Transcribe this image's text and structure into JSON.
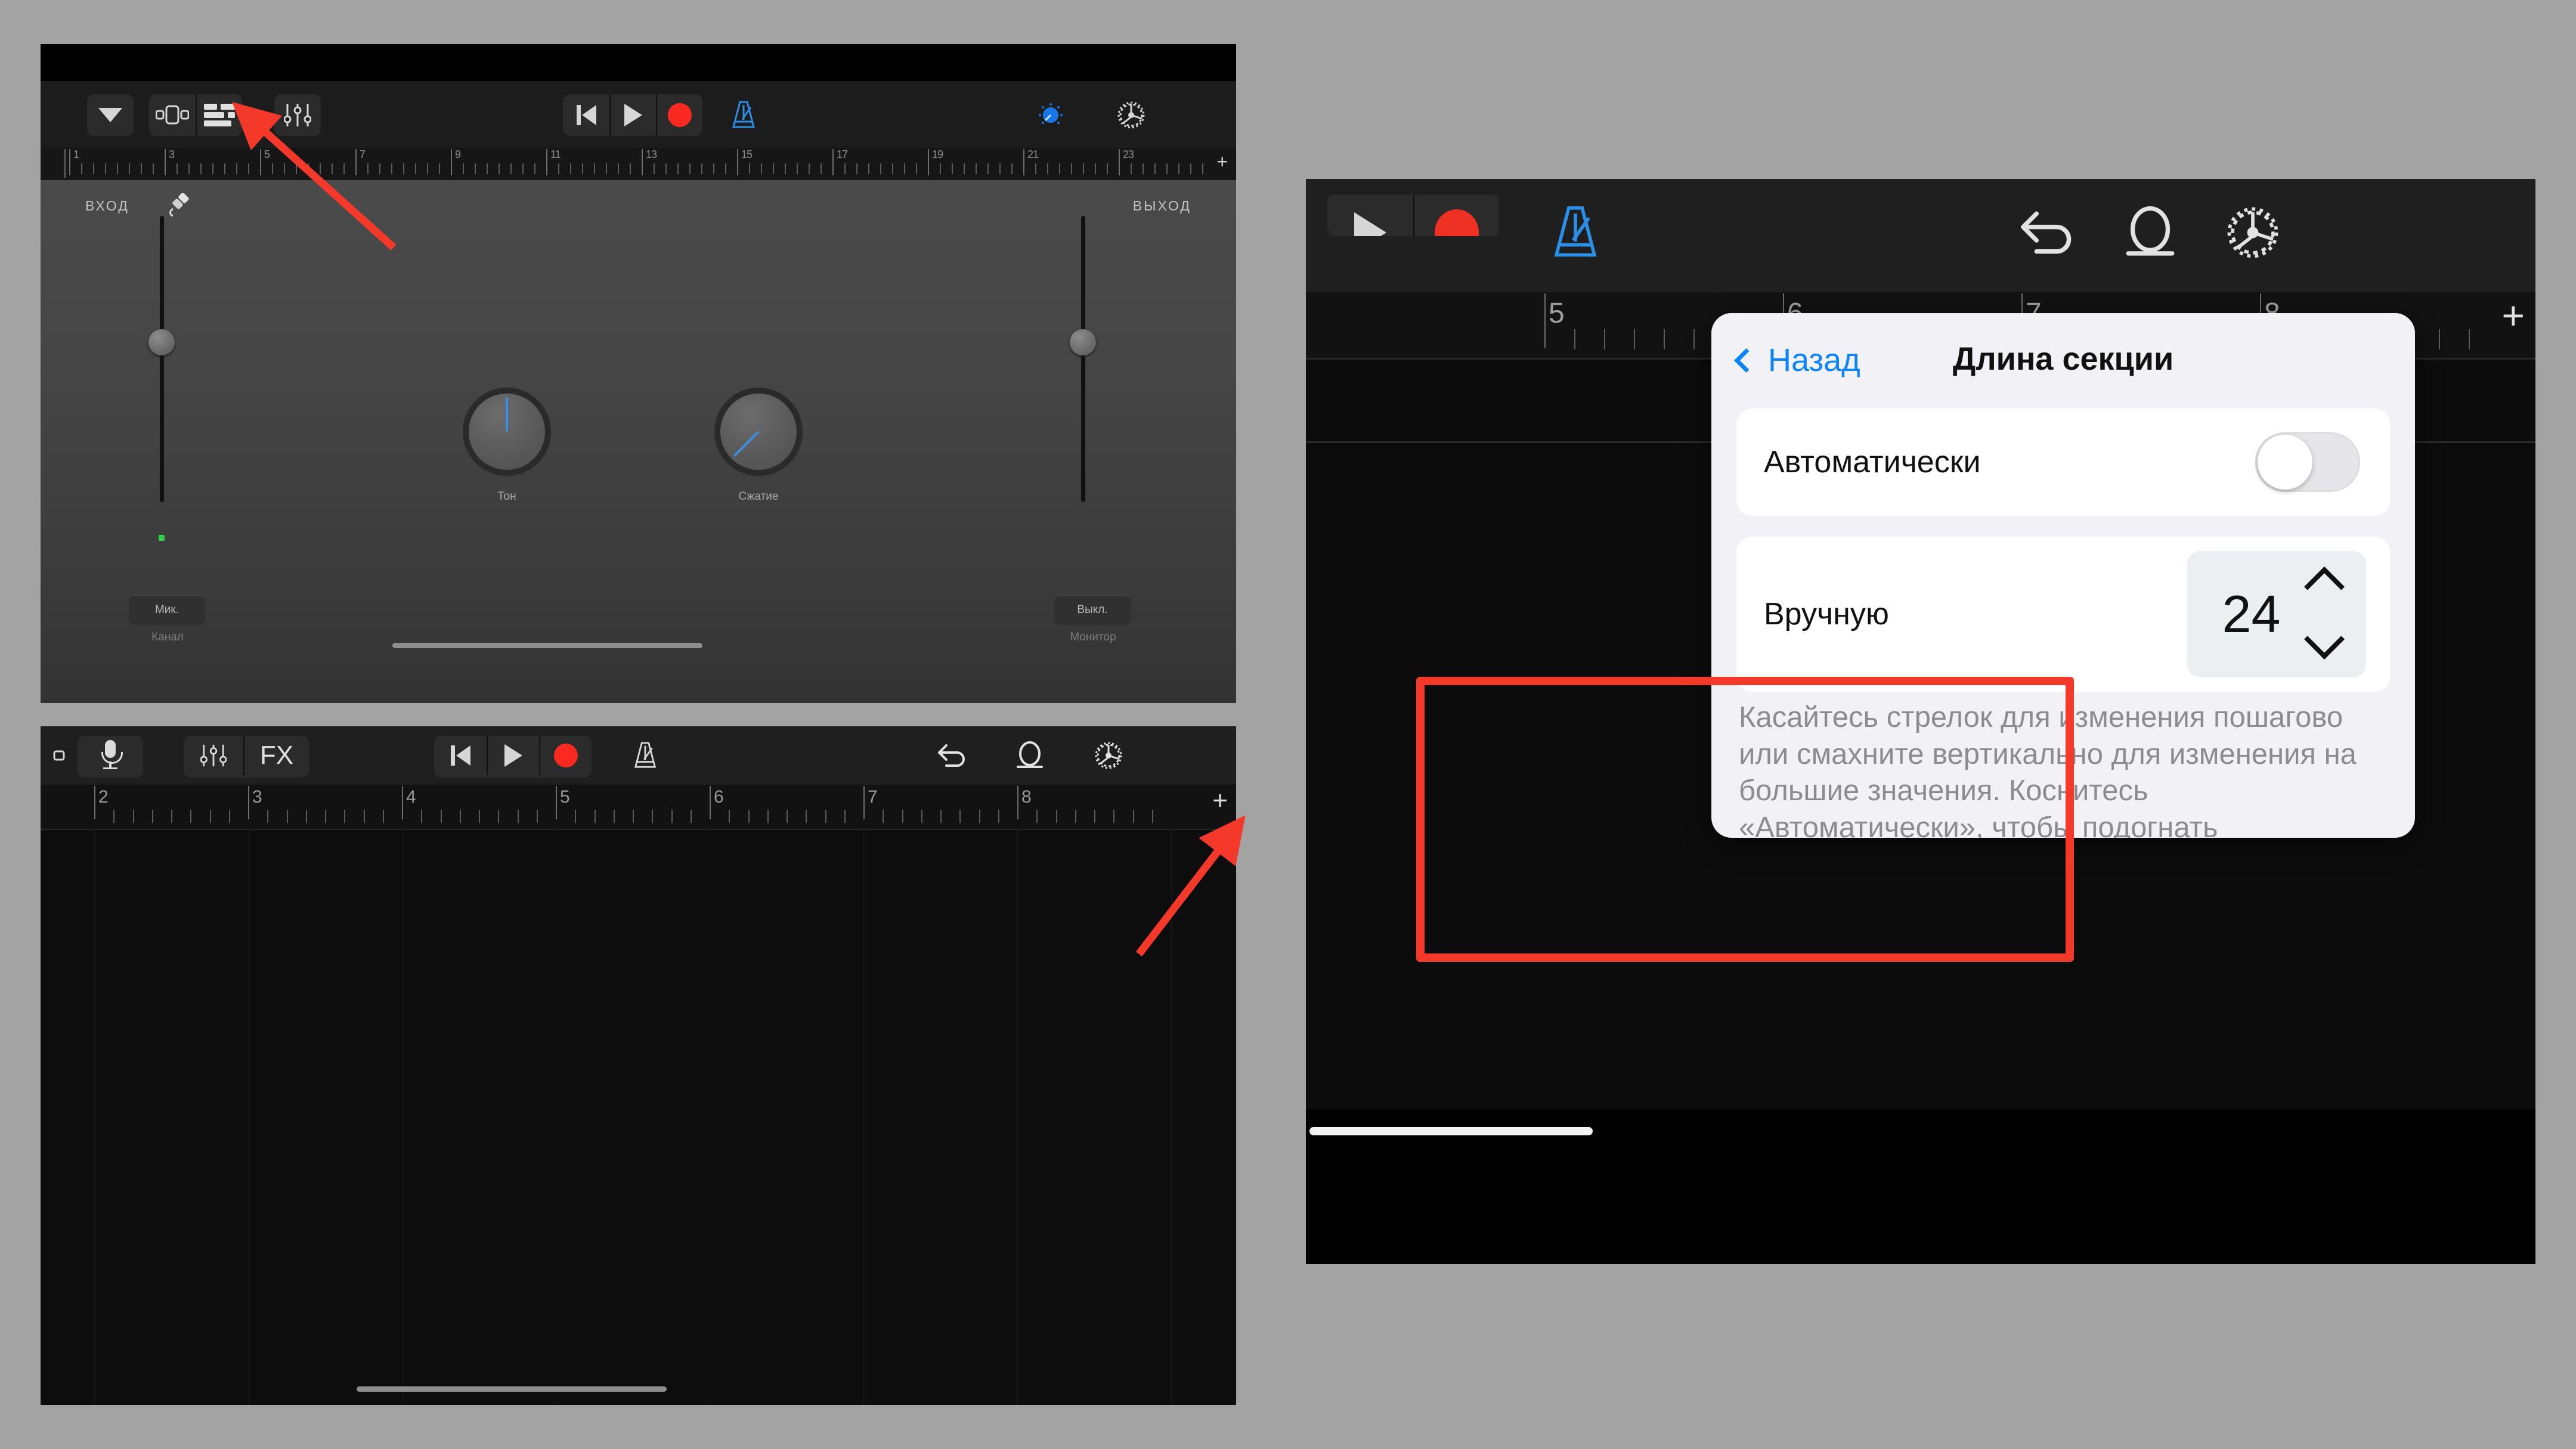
{
  "meta": {
    "accent_blue": "#0a84ff",
    "record_red": "#fb2a20",
    "highlight_red": "#f4392a",
    "metronome_blue": "#2a8fe8"
  },
  "panel_one": {
    "name": "GarageBand track controls panel",
    "toolbar": {
      "left_group": [
        {
          "name": "collapse-triangle-button",
          "icon": "triangle-down-icon"
        },
        {
          "name": "track-view-button",
          "icon": "instrument-view-icon"
        },
        {
          "name": "tracks-list-button",
          "icon": "tracks-list-icon"
        },
        {
          "name": "mixer-button",
          "icon": "sliders-icon"
        }
      ],
      "transport": [
        {
          "name": "rewind-button",
          "icon": "skip-back-icon"
        },
        {
          "name": "play-button",
          "icon": "play-icon"
        },
        {
          "name": "record-button",
          "icon": "record-circle-icon"
        }
      ],
      "metronome": {
        "name": "metronome-button",
        "icon": "metronome-icon",
        "active": true
      },
      "right": [
        {
          "name": "master-effects-button",
          "icon": "knob-blue-icon"
        },
        {
          "name": "settings-button",
          "icon": "gear-icon"
        }
      ]
    },
    "ruler": {
      "labels": [
        "1",
        "3",
        "5",
        "7",
        "9",
        "11",
        "13",
        "15",
        "17",
        "19",
        "21",
        "23"
      ],
      "add_button": "+"
    },
    "input_label": "ВХОД",
    "input_icon": "instrument-plug-icon",
    "output_label": "ВЫХОД",
    "knobs": [
      {
        "label": "Тон",
        "name": "tone-knob",
        "angle_deg": 0
      },
      {
        "label": "Сжатие",
        "name": "compressor-knob",
        "angle_deg": -135
      }
    ],
    "channel": {
      "value": "Мик.",
      "caption": "Канал"
    },
    "monitor": {
      "value": "Выкл.",
      "caption": "Монитор"
    }
  },
  "panel_two": {
    "name": "GarageBand empty tracks view",
    "toolbar": {
      "left": [
        {
          "name": "navigation-button",
          "icon": "small-square-icon"
        },
        {
          "name": "microphone-button",
          "icon": "microphone-icon"
        },
        {
          "name": "mixer-button",
          "icon": "sliders-icon"
        },
        {
          "name": "fx-button",
          "icon": "fx-label-icon",
          "label": "FX"
        }
      ],
      "transport": [
        {
          "name": "rewind-button",
          "icon": "skip-back-icon"
        },
        {
          "name": "play-button",
          "icon": "play-icon"
        },
        {
          "name": "record-button",
          "icon": "record-circle-icon"
        }
      ],
      "metronome": {
        "name": "metronome-button",
        "icon": "metronome-icon"
      },
      "right": [
        {
          "name": "undo-button",
          "icon": "undo-arrow-icon"
        },
        {
          "name": "loop-button",
          "icon": "loop-icon"
        },
        {
          "name": "settings-button",
          "icon": "gear-icon"
        }
      ]
    },
    "ruler": {
      "labels": [
        "2",
        "3",
        "4",
        "5",
        "6",
        "7",
        "8"
      ],
      "add_button": "+"
    }
  },
  "panel_three": {
    "name": "Section Length popover over GarageBand",
    "toolbar": {
      "transport": [
        {
          "name": "play-button",
          "icon": "play-icon"
        },
        {
          "name": "record-button",
          "icon": "record-circle-icon"
        }
      ],
      "metronome": {
        "name": "metronome-button",
        "icon": "metronome-icon",
        "active": true
      },
      "right": [
        {
          "name": "undo-button",
          "icon": "undo-arrow-icon"
        },
        {
          "name": "loop-button",
          "icon": "loop-icon"
        },
        {
          "name": "settings-button",
          "icon": "gear-icon"
        }
      ]
    },
    "ruler": {
      "labels": [
        "5",
        "6",
        "7",
        "8"
      ],
      "add_button": "+"
    },
    "popover": {
      "back_label": "Назад",
      "title": "Длина секции",
      "auto_row": {
        "label": "Автоматически",
        "toggle_on": false
      },
      "manual_row": {
        "label": "Вручную",
        "value": "24",
        "increment_icon": "chevron-up-icon",
        "decrement_icon": "chevron-down-icon"
      },
      "description": "Касайтесь стрелок для изменения пошагово или смахните вертикально для изменения на большие значения. Коснитесь «Автоматически», чтобы подогнать длительность к длительности Вашей записи."
    }
  },
  "annotations": [
    {
      "name": "arrow-to-tracks-list-button",
      "color": "#f4392a"
    },
    {
      "name": "arrow-to-add-section-button",
      "color": "#f4392a"
    },
    {
      "name": "highlight-box-manual-row",
      "color": "#f4392a"
    }
  ]
}
